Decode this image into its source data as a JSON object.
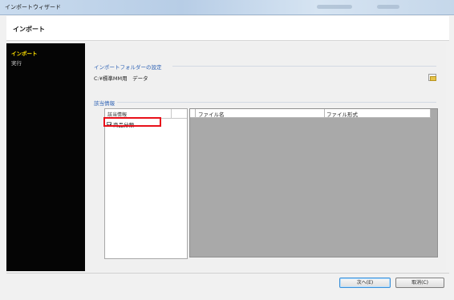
{
  "window": {
    "title": "インポートウィザード"
  },
  "header": {
    "heading": "インポート"
  },
  "sidebar": {
    "items": [
      {
        "label": "インポート",
        "state": "active"
      },
      {
        "label": "実行",
        "state": "inactive"
      }
    ]
  },
  "import_folder": {
    "section_title": "インポートフォルダーの設定",
    "path": "C:¥標準MM用　データ",
    "browse_icon": "folder-icon"
  },
  "related_info": {
    "section_title": "該当情報",
    "list_header": "該当情報",
    "items": [
      {
        "label": "商品分類",
        "checked": true
      }
    ],
    "highlight_color": "#e8101a"
  },
  "file_grid": {
    "columns": [
      "ファイル名",
      "ファイル形式"
    ]
  },
  "buttons": {
    "next": "次へ(E)",
    "cancel": "取消(C)"
  },
  "colors": {
    "sidebar_bg": "#050505",
    "sidebar_active": "#ffe000",
    "section_title": "#2f63b5",
    "grid_bg": "#a9a9a9"
  }
}
